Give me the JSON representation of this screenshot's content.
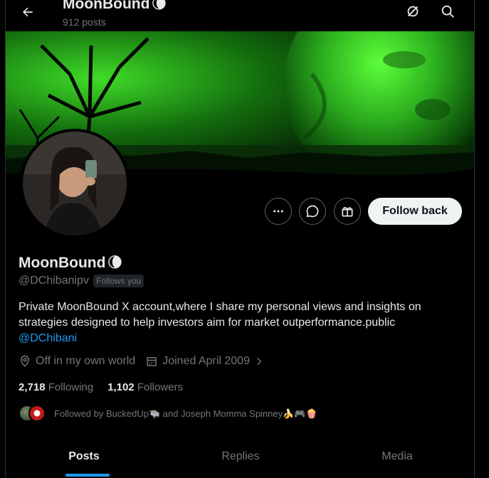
{
  "header": {
    "title": "MoonBound",
    "title_emoji": "🌘",
    "posts_count": "912 posts"
  },
  "profile": {
    "name": "MoonBound",
    "name_emoji": "🌘",
    "handle": "@DChibanipv",
    "follows_you": "Follows you",
    "bio": "Private MoonBound X account,where I share my personal views and insights on strategies designed to help investors aim for market outperformance.public",
    "bio_link": "@DChibani",
    "location": "Off in my own world",
    "joined": "Joined April 2009",
    "following_count": "2,718",
    "following_label": "Following",
    "followers_count": "1,102",
    "followers_label": "Followers",
    "followed_by": "Followed by BuckedUp🐃 and Joseph Momma Spinney🍌🎮🍿"
  },
  "actions": {
    "follow_back_label": "Follow back"
  },
  "tabs": [
    {
      "label": "Posts",
      "active": true
    },
    {
      "label": "Replies",
      "active": false
    },
    {
      "label": "Media",
      "active": false
    }
  ],
  "colors": {
    "accent": "#1d9bf0",
    "background": "#000000",
    "secondary_text": "#71767b",
    "banner_green": "#27b318"
  },
  "icons": [
    "back-arrow-icon",
    "grok-icon",
    "search-icon",
    "more-icon",
    "message-icon",
    "gift-icon",
    "location-icon",
    "calendar-icon",
    "chevron-right-icon"
  ]
}
